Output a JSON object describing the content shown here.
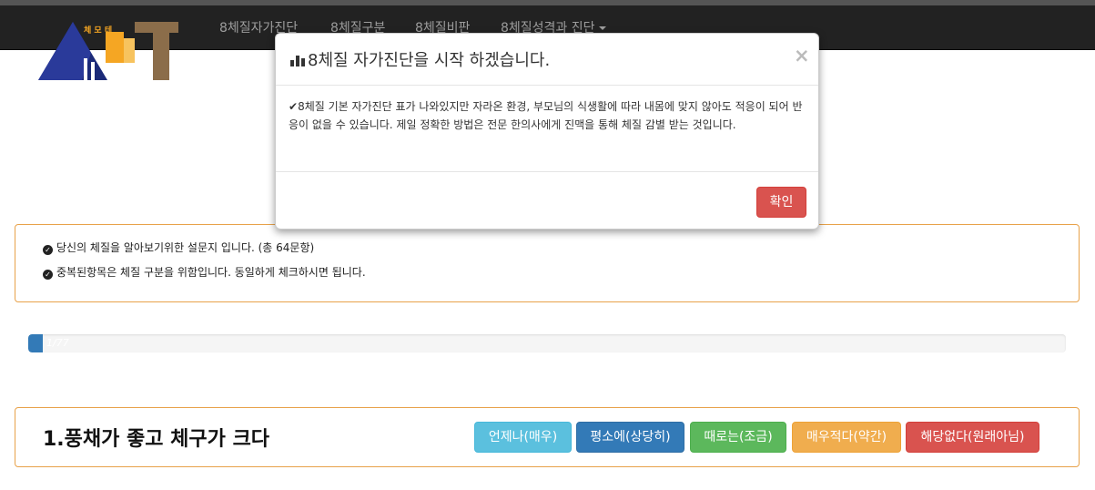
{
  "nav": {
    "items": [
      {
        "label": "8체질자가진단"
      },
      {
        "label": "8체질구분"
      },
      {
        "label": "8체질비판"
      },
      {
        "label": "8체질성격과 진단"
      }
    ]
  },
  "logo": {
    "text": "체 모 테"
  },
  "info": {
    "line1": "당신의 체질을 알아보기위한 설문지 입니다. (총 64문항)",
    "line2": "중복된항목은 체질 구분을 위함입니다. 동일하게 체크하시면 됩니다."
  },
  "progress": {
    "text": "1/77",
    "value": 0.014
  },
  "question": {
    "title": "1.풍채가 좋고 체구가 크다",
    "options": [
      "언제나(매우)",
      "평소에(상당히)",
      "때로는(조금)",
      "매우적다(약간)",
      "해당없다(원래아님)"
    ]
  },
  "modal": {
    "title": "8체질 자가진단을 시작 하겠습니다.",
    "close": "×",
    "body": "8체질 기본 자가진단 표가 나와있지만 자라온 환경, 부모님의 식생활에 따라 내몸에 맞지 않아도 적응이 되어 반응이 없을 수 있습니다. 제일 정확한 방법은 전문 한의사에게 진맥을 통해 체질 감별 받는 것입니다.",
    "ok": "확인"
  },
  "colors": {
    "navbar": "#222222",
    "accent_border": "#e8a24a",
    "info": "#5bc0de",
    "primary": "#337ab7",
    "success": "#5cb85c",
    "warning": "#f0ad4e",
    "danger": "#d9534f"
  }
}
